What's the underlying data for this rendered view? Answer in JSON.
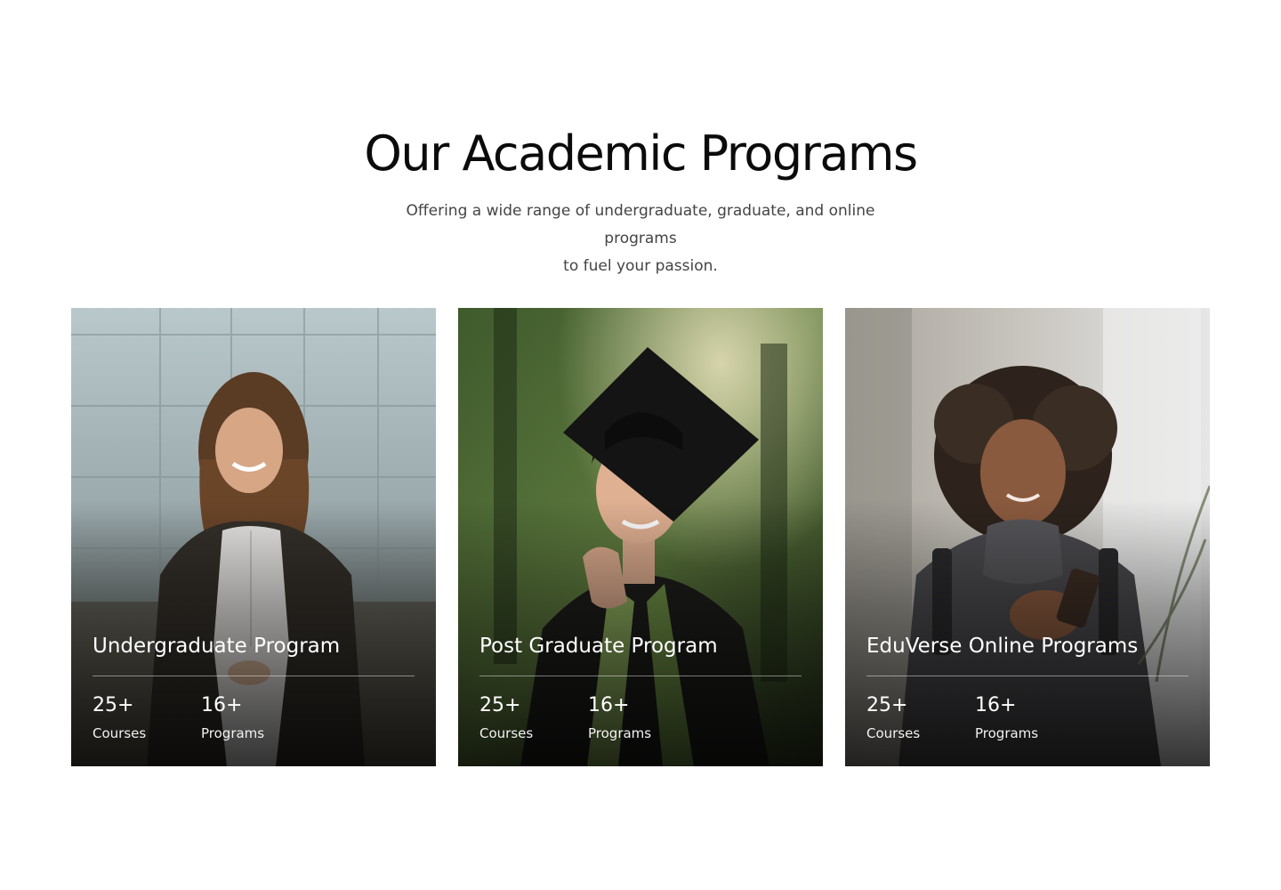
{
  "section": {
    "title": "Our Academic Programs",
    "subtitle_line1": "Offering a wide range of undergraduate, graduate, and online programs",
    "subtitle_line2": "to fuel your passion."
  },
  "cards": [
    {
      "title": "Undergraduate Program",
      "stats": [
        {
          "value": "25+",
          "label": "Courses"
        },
        {
          "value": "16+",
          "label": "Programs"
        }
      ],
      "photo_icon": "student-woman-photo"
    },
    {
      "title": "Post Graduate Program",
      "stats": [
        {
          "value": "25+",
          "label": "Courses"
        },
        {
          "value": "16+",
          "label": "Programs"
        }
      ],
      "photo_icon": "graduate-man-photo"
    },
    {
      "title": "EduVerse Online Programs",
      "stats": [
        {
          "value": "25+",
          "label": "Courses"
        },
        {
          "value": "16+",
          "label": "Programs"
        }
      ],
      "photo_icon": "student-phone-photo"
    }
  ],
  "colors": {
    "background": "#ffffff",
    "heading": "#0b0b0b",
    "subtitle": "#444444",
    "card_text": "#ffffff"
  }
}
